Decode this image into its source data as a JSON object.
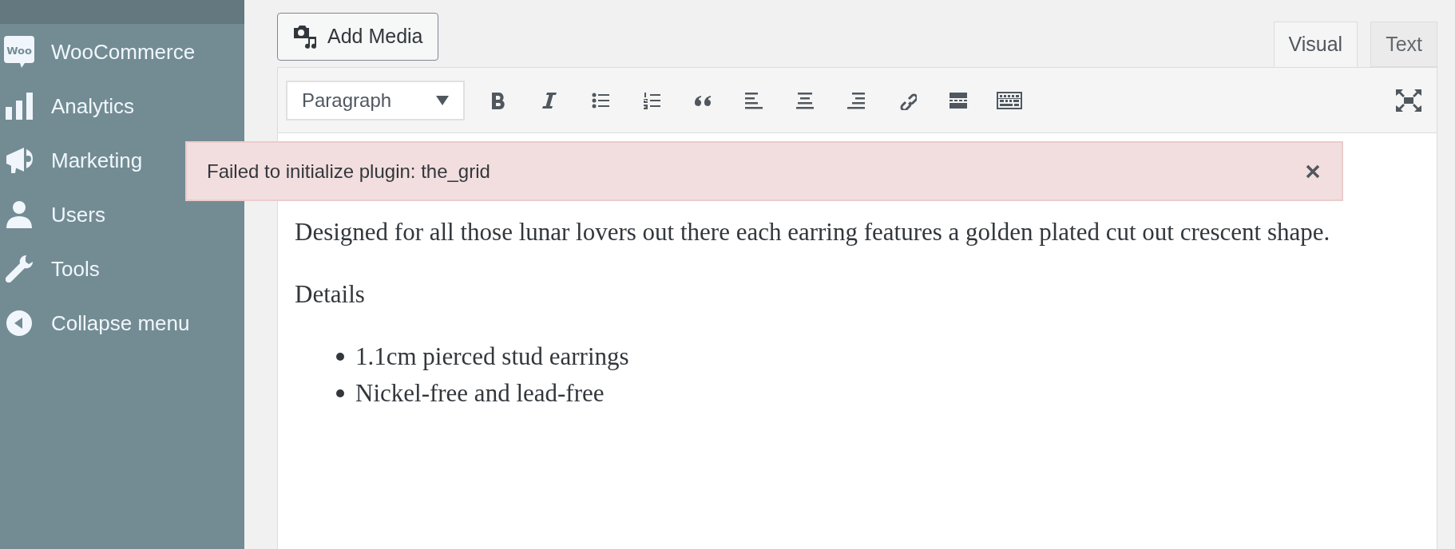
{
  "sidebar": {
    "items": [
      {
        "label": "WooCommerce",
        "logo_text": "Woo"
      },
      {
        "label": "Analytics"
      },
      {
        "label": "Marketing"
      },
      {
        "label": "Users"
      },
      {
        "label": "Tools"
      },
      {
        "label": "Collapse menu"
      }
    ]
  },
  "add_media_button": "Add Media",
  "editor_tabs": [
    {
      "label": "Visual",
      "selected": true
    },
    {
      "label": "Text",
      "selected": false
    }
  ],
  "toolbar": {
    "format_select": "Paragraph"
  },
  "notice": {
    "message": "Failed to initialize plugin: the_grid"
  },
  "content": {
    "paragraph": "Designed for all those lunar lovers out there each earring features a golden plated cut out crescent shape.",
    "heading": "Details",
    "bullets": [
      "1.1cm pierced stud earrings",
      "Nickel-free and lead-free"
    ]
  }
}
